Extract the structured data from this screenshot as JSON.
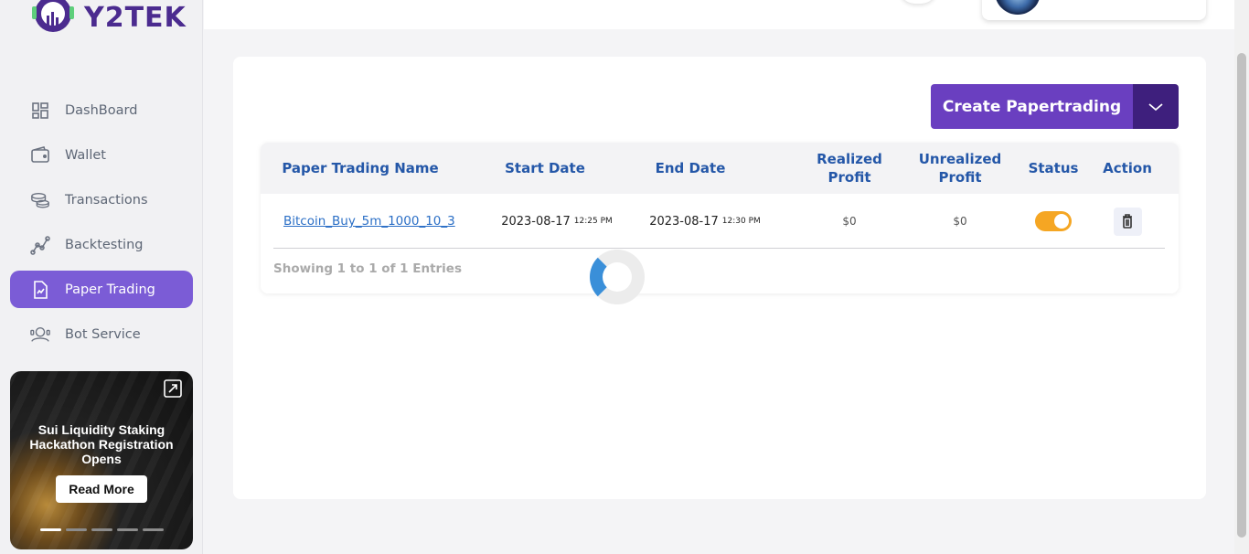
{
  "brand": {
    "logo_text": "Y2TEK",
    "accent": "#7b5cd6",
    "primary": "#6a3fc0"
  },
  "sidebar": {
    "items": [
      {
        "label": "DashBoard",
        "icon": "dashboard-icon"
      },
      {
        "label": "Wallet",
        "icon": "wallet-icon"
      },
      {
        "label": "Transactions",
        "icon": "coins-icon"
      },
      {
        "label": "Backtesting",
        "icon": "chart-line-icon"
      },
      {
        "label": "Paper Trading",
        "icon": "document-chart-icon",
        "active": true
      },
      {
        "label": "Bot Service",
        "icon": "bot-service-icon"
      }
    ],
    "promo": {
      "title": "Sui Liquidity Staking Hackathon Registration Opens",
      "button": "Read More",
      "slides_total": 5,
      "active_slide": 1
    }
  },
  "main": {
    "create_button": "Create Papertrading",
    "table": {
      "headers": {
        "name": "Paper Trading Name",
        "start": "Start Date",
        "end": "End Date",
        "realized": "Realized Profit",
        "unrealized": "Unrealized Profit",
        "status": "Status",
        "action": "Action"
      },
      "rows": [
        {
          "name": "Bitcoin_Buy_5m_1000_10_3",
          "start_date": "2023-08-17",
          "start_time": "12:25 PM",
          "end_date": "2023-08-17",
          "end_time": "12:30 PM",
          "realized": "$0",
          "unrealized": "$0",
          "status_on": true
        }
      ],
      "footer": "Showing 1 to 1 of 1 Entries"
    }
  }
}
